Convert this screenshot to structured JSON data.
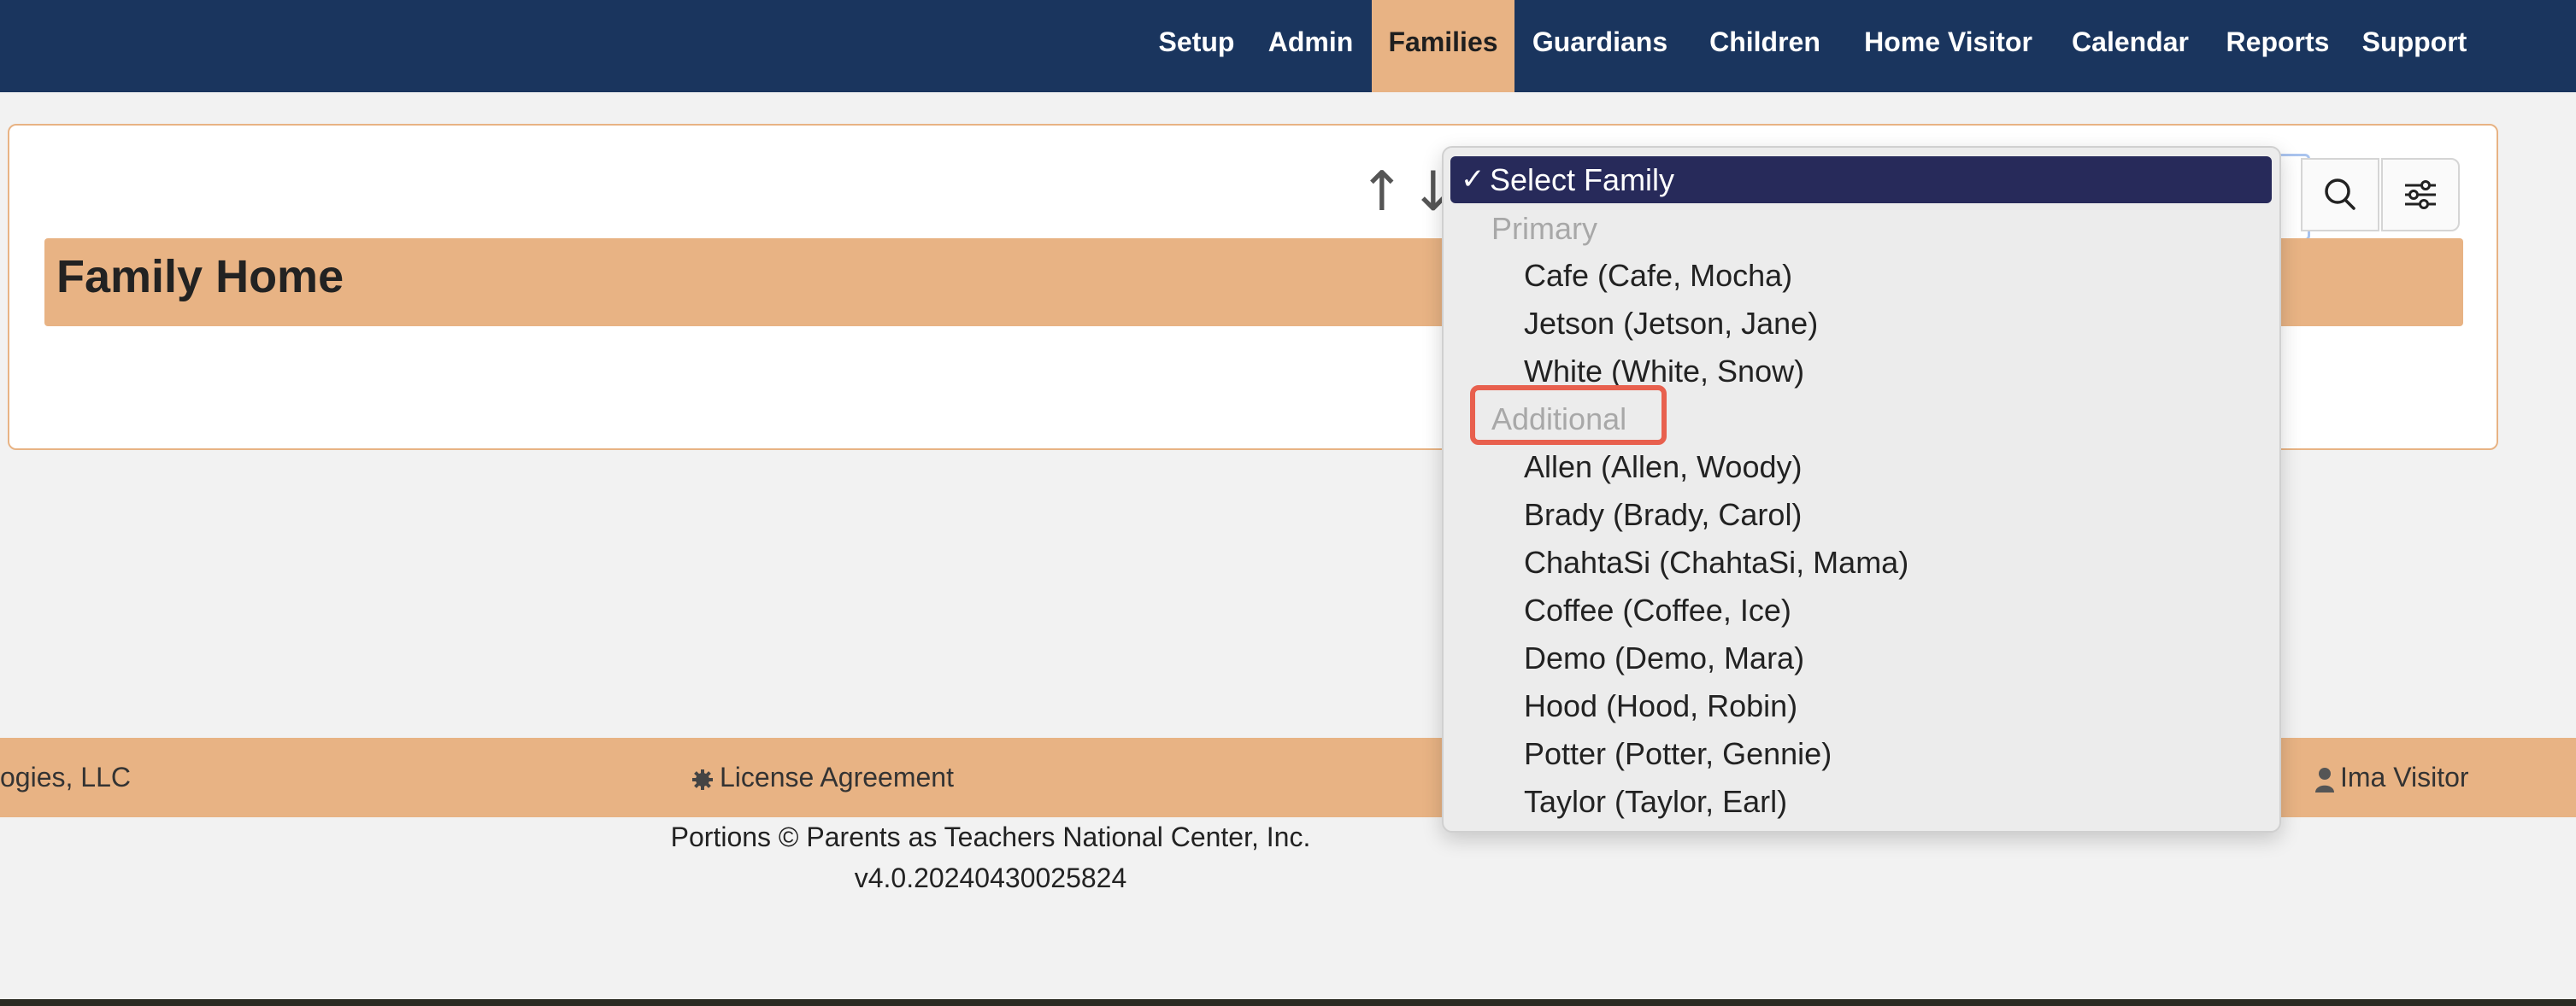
{
  "nav": {
    "items": [
      "Setup",
      "Admin",
      "Families",
      "Guardians",
      "Children",
      "Home Visitor",
      "Calendar",
      "Reports",
      "Support"
    ],
    "active": "Families"
  },
  "main": {
    "title": "Family Home",
    "sort_up_glyph": "↑",
    "sort_down_glyph": "↓"
  },
  "dropdown": {
    "selected_label": "Select Family",
    "check_glyph": "✓",
    "groups": [
      {
        "label": "Primary",
        "options": [
          "Cafe (Cafe, Mocha)",
          "Jetson (Jetson, Jane)",
          "White (White, Snow)"
        ]
      },
      {
        "label": "Additional",
        "options": [
          "Allen (Allen, Woody)",
          "Brady (Brady, Carol)",
          "ChahtaSi (ChahtaSi, Mama)",
          "Coffee (Coffee, Ice)",
          "Demo (Demo, Mara)",
          "Hood (Hood, Robin)",
          "Potter (Potter, Gennie)",
          "Taylor (Taylor, Earl)"
        ]
      }
    ],
    "highlighted_group": "Additional"
  },
  "footer": {
    "company": "ogies, LLC",
    "license": "License Agreement",
    "user": "Ima Visitor",
    "portions": "Portions © Parents as Teachers National Center, Inc.",
    "version": "v4.0.20240430025824"
  },
  "colors": {
    "navbar": "#1a355e",
    "accent": "#e8b384",
    "selected_option": "#272a5a",
    "highlight": "#e8604e"
  },
  "icons": [
    "search-icon",
    "filter-settings-icon",
    "gear-icon",
    "user-icon",
    "arrow-up-icon",
    "arrow-down-icon",
    "checkmark-icon"
  ]
}
